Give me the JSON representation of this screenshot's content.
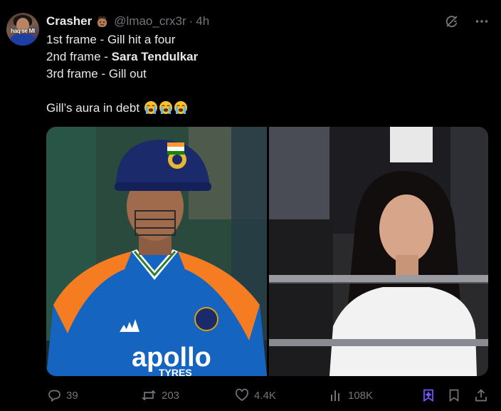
{
  "author": {
    "name": "Crasher",
    "handle": "@lmao_crx3r",
    "separator": "·",
    "time": "4h",
    "avatar_text": "haq se MI"
  },
  "tweet": {
    "lines": [
      {
        "text": "1st frame - Gill hit a four"
      },
      {
        "prefix": "2nd frame - ",
        "bold": "Sara Tendulkar"
      },
      {
        "text": "3rd frame - Gill out"
      },
      {
        "text": ""
      },
      {
        "text": "Gill’s aura in debt",
        "emoji": "loudly-crying-face",
        "emoji_count": 3
      }
    ]
  },
  "media": {
    "left_image_text": "apollo",
    "left_image_subtext": "TYRES"
  },
  "actions": {
    "replies": "39",
    "reposts": "203",
    "likes": "4.4K",
    "views": "108K"
  },
  "colors": {
    "text": "#e7e9ea",
    "muted": "#71767b",
    "accent": "#7856ff",
    "background": "#000000"
  }
}
